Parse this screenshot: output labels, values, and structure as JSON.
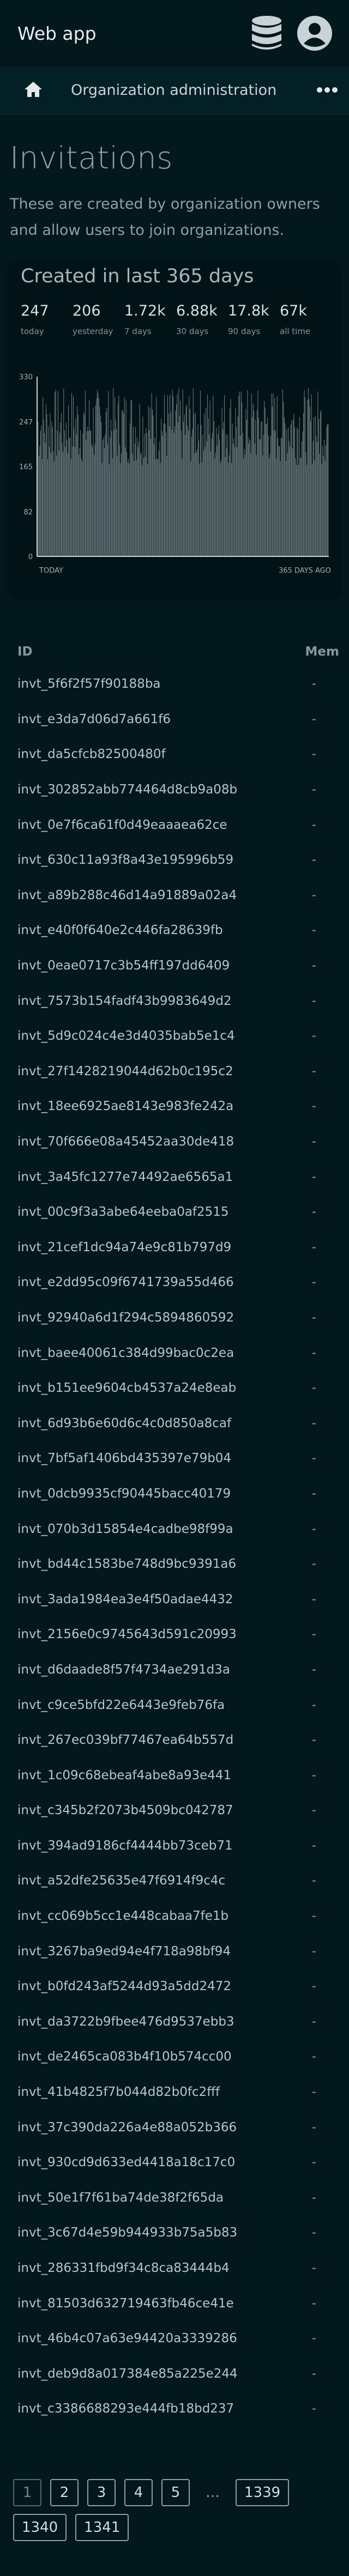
{
  "app": {
    "title": "Web app"
  },
  "nav": {
    "title": "Organization administration"
  },
  "page": {
    "title": "Invitations",
    "description": "These are created by organization owners and allow users to join organizations."
  },
  "card": {
    "title": "Created in last 365 days",
    "stats": [
      {
        "value": "247",
        "label": "today"
      },
      {
        "value": "206",
        "label": "yesterday"
      },
      {
        "value": "1.72k",
        "label": "7 days"
      },
      {
        "value": "6.88k",
        "label": "30 days"
      },
      {
        "value": "17.8k",
        "label": "90 days"
      },
      {
        "value": "67k",
        "label": "all time"
      }
    ]
  },
  "chart_data": {
    "type": "bar",
    "title": "",
    "xlabel": "",
    "ylabel": "",
    "x_tick_labels": [
      "TODAY",
      "365 DAYS AGO"
    ],
    "y_ticks": [
      0,
      82,
      165,
      247,
      330
    ],
    "ylim": [
      0,
      330
    ],
    "n_bars": 365,
    "grid": false,
    "legend": "none",
    "bar_color": "#7f8d91",
    "values_note_range": [
      120,
      310
    ]
  },
  "table": {
    "headers": {
      "id": "ID",
      "member": "Mem"
    },
    "rows": [
      "invt_5f6f2f57f90188ba",
      "invt_e3da7d06d7a661f6",
      "invt_da5cfcb82500480f",
      "invt_302852abb774464d8cb9a08b",
      "invt_0e7f6ca61f0d49eaaaea62ce",
      "invt_630c11a93f8a43e195996b59",
      "invt_a89b288c46d14a91889a02a4",
      "invt_e40f0f640e2c446fa28639fb",
      "invt_0eae0717c3b54ff197dd6409",
      "invt_7573b154fadf43b9983649d2",
      "invt_5d9c024c4e3d4035bab5e1c4",
      "invt_27f1428219044d62b0c195c2",
      "invt_18ee6925ae8143e983fe242a",
      "invt_70f666e08a45452aa30de418",
      "invt_3a45fc1277e74492ae6565a1",
      "invt_00c9f3a3abe64eeba0af2515",
      "invt_21cef1dc94a74e9c81b797d9",
      "invt_e2dd95c09f6741739a55d466",
      "invt_92940a6d1f294c5894860592",
      "invt_baee40061c384d99bac0c2ea",
      "invt_b151ee9604cb4537a24e8eab",
      "invt_6d93b6e60d6c4c0d850a8caf",
      "invt_7bf5af1406bd435397e79b04",
      "invt_0dcb9935cf90445bacc40179",
      "invt_070b3d15854e4cadbe98f99a",
      "invt_bd44c1583be748d9bc9391a6",
      "invt_3ada1984ea3e4f50adae4432",
      "invt_2156e0c9745643d591c20993",
      "invt_d6daade8f57f4734ae291d3a",
      "invt_c9ce5bfd22e6443e9feb76fa",
      "invt_267ec039bf77467ea64b557d",
      "invt_1c09c68ebeaf4abe8a93e441",
      "invt_c345b2f2073b4509bc042787",
      "invt_394ad9186cf4444bb73ceb71",
      "invt_a52dfe25635e47f6914f9c4c",
      "invt_cc069b5cc1e448cabaa7fe1b",
      "invt_3267ba9ed94e4f718a98bf94",
      "invt_b0fd243af5244d93a5dd2472",
      "invt_da3722b9fbee476d9537ebb3",
      "invt_de2465ca083b4f10b574cc00",
      "invt_41b4825f7b044d82b0fc2fff",
      "invt_37c390da226a4e88a052b366",
      "invt_930cd9d633ed4418a18c17c0",
      "invt_50e1f7f61ba74de38f2f65da",
      "invt_3c67d4e59b944933b75a5b83",
      "invt_286331fbd9f34c8ca83444b4",
      "invt_81503d632719463fb46ce41e",
      "invt_46b4c07a63e94420a3339286",
      "invt_deb9d8a017384e85a225e244",
      "invt_c3386688293e444fb18bd237"
    ],
    "member_placeholder": "-"
  },
  "pagination": [
    "1",
    "2",
    "3",
    "4",
    "5",
    "…",
    "1339",
    "1340",
    "1341"
  ],
  "colors": {
    "background": "#02181c",
    "card": "#021317",
    "bars": "#7f8d91"
  }
}
